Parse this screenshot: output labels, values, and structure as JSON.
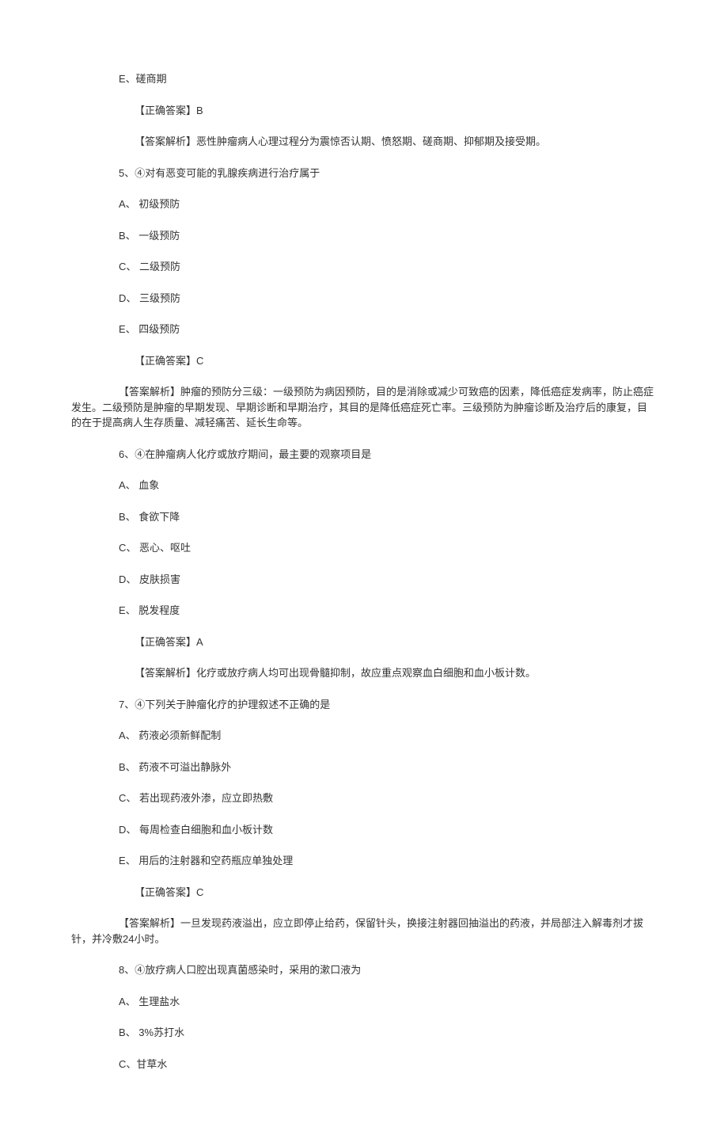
{
  "lines": [
    {
      "cls": "indent1",
      "text": "E、磋商期"
    },
    {
      "cls": "indent2",
      "text": "【正确答案】B"
    },
    {
      "cls": "indent2",
      "text": "【答案解析】恶性肿瘤病人心理过程分为震惊否认期、愤怒期、磋商期、抑郁期及接受期。"
    },
    {
      "cls": "indent1",
      "text": "5、④对有恶变可能的乳腺疾病进行治疗属于"
    },
    {
      "cls": "indent1",
      "text": "A、 初级预防"
    },
    {
      "cls": "indent1",
      "text": "B、 一级预防"
    },
    {
      "cls": "indent1",
      "text": "C、 二级预防"
    },
    {
      "cls": "indent1",
      "text": "D、 三级预防"
    },
    {
      "cls": "indent1",
      "text": "E、 四级预防"
    },
    {
      "cls": "indent2",
      "text": "【正确答案】C"
    },
    {
      "cls": "para",
      "text": "【答案解析】肿瘤的预防分三级：一级预防为病因预防，目的是消除或减少可致癌的因素，降低癌症发病率，防止癌症发生。二级预防是肿瘤的早期发现、早期诊断和早期治疗，其目的是降低癌症死亡率。三级预防为肿瘤诊断及治疗后的康复，目的在于提高病人生存质量、减轻痛苦、延长生命等。"
    },
    {
      "cls": "indent1",
      "text": "6、④在肿瘤病人化疗或放疗期间，最主要的观察项目是"
    },
    {
      "cls": "indent1",
      "text": "A、 血象"
    },
    {
      "cls": "indent1",
      "text": "B、 食欲下降"
    },
    {
      "cls": "indent1",
      "text": "C、 恶心、呕吐"
    },
    {
      "cls": "indent1",
      "text": "D、 皮肤损害"
    },
    {
      "cls": "indent1",
      "text": "E、 脱发程度"
    },
    {
      "cls": "indent2",
      "text": "【正确答案】A"
    },
    {
      "cls": "indent2",
      "text": "【答案解析】化疗或放疗病人均可出现骨髓抑制，故应重点观察血白细胞和血小板计数。"
    },
    {
      "cls": "indent1",
      "text": " 7、④下列关于肿瘤化疗的护理叙述不正确的是"
    },
    {
      "cls": "indent1",
      "text": "A、 药液必须新鲜配制"
    },
    {
      "cls": "indent1",
      "text": "B、 药液不可溢出静脉外"
    },
    {
      "cls": "indent1",
      "text": "C、 若出现药液外渗，应立即热敷"
    },
    {
      "cls": "indent1",
      "text": "D、 每周检查白细胞和血小板计数"
    },
    {
      "cls": "indent1",
      "text": "E、 用后的注射器和空药瓶应单独处理"
    },
    {
      "cls": "indent2",
      "text": "【正确答案】C"
    },
    {
      "cls": "para",
      "text": "【答案解析】一旦发现药液溢出，应立即停止给药，保留针头，换接注射器回抽溢出的药液，并局部注入解毒剂才拔针，并冷敷24小时。"
    },
    {
      "cls": "indent1",
      "text": "8、④放疗病人口腔出现真菌感染时，采用的漱口液为"
    },
    {
      "cls": "indent1",
      "text": "A、 生理盐水"
    },
    {
      "cls": "indent1",
      "text": "B、 3%苏打水"
    },
    {
      "cls": "indent1",
      "text": "C、甘草水"
    }
  ]
}
